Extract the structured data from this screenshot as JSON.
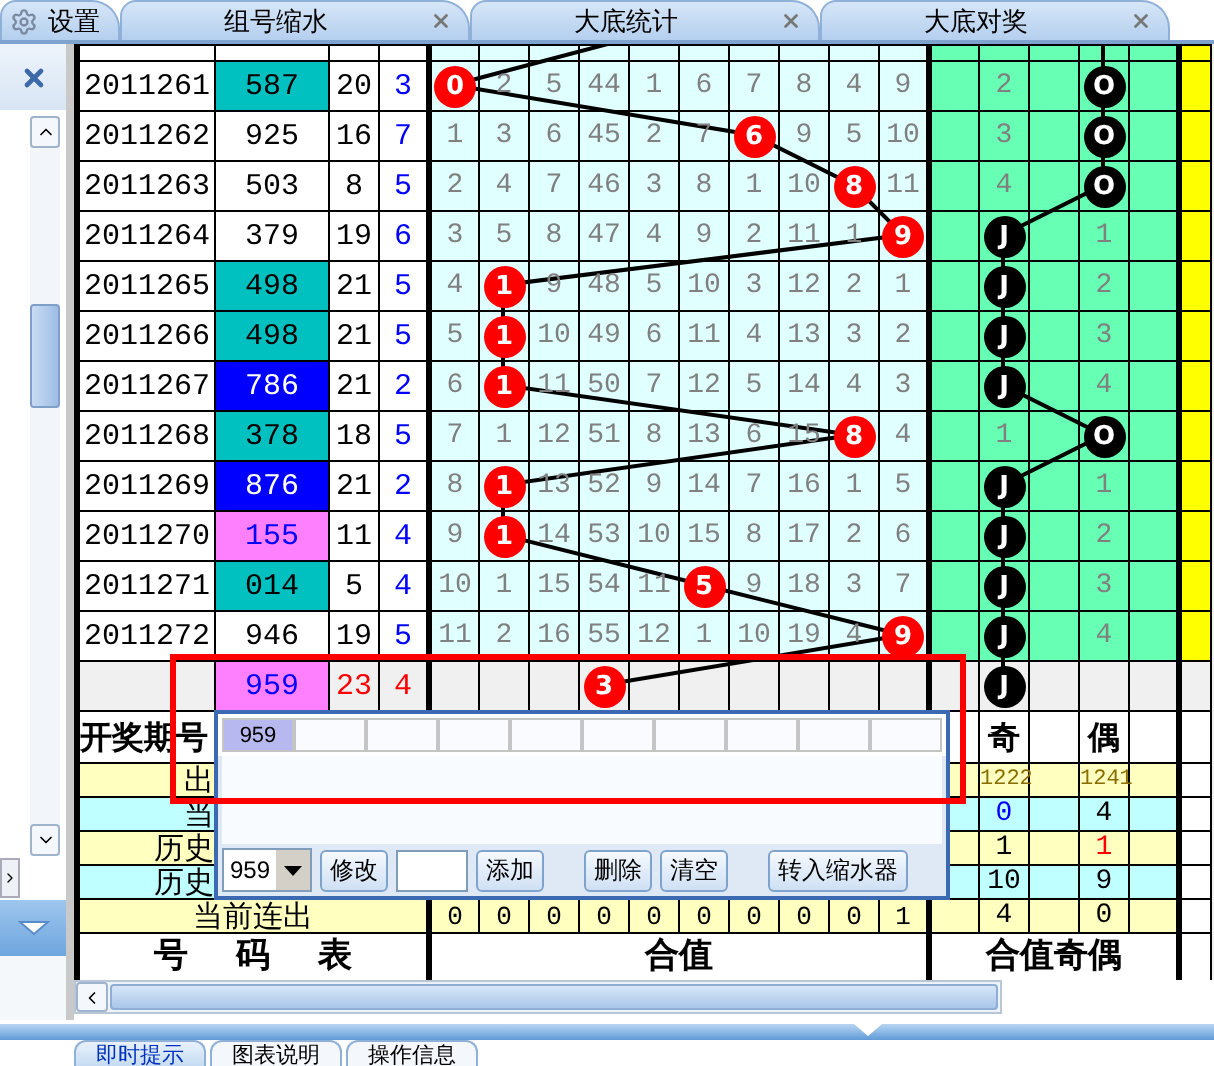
{
  "tabs": [
    {
      "label": "设置",
      "kind": "settings",
      "selected": false
    },
    {
      "label": "组号缩水",
      "kind": "closable",
      "selected": false
    },
    {
      "label": "大底统计",
      "kind": "closable",
      "selected": false
    },
    {
      "label": "大底对奖",
      "kind": "closable",
      "selected": false
    }
  ],
  "rows": [
    {
      "kind": "draw",
      "period": "2011261",
      "number": "587",
      "color": "#00c0c0",
      "sum": "20",
      "tail": "3",
      "cells": [
        {
          "kind": "ball",
          "text": "0"
        },
        {
          "kind": "num",
          "text": "2"
        },
        {
          "kind": "num",
          "text": "5"
        },
        {
          "kind": "num",
          "text": "44"
        },
        {
          "kind": "num",
          "text": "1"
        },
        {
          "kind": "num",
          "text": "6"
        },
        {
          "kind": "num",
          "text": "7"
        },
        {
          "kind": "num",
          "text": "8"
        },
        {
          "kind": "num",
          "text": "4"
        },
        {
          "kind": "num",
          "text": "9"
        }
      ],
      "parity": {
        "kind": "even",
        "ball": "O",
        "count": "2"
      }
    },
    {
      "kind": "draw",
      "period": "2011262",
      "number": "925",
      "color": "#ffffff",
      "sum": "16",
      "tail": "7",
      "cells": [
        {
          "kind": "num",
          "text": "1"
        },
        {
          "kind": "num",
          "text": "3"
        },
        {
          "kind": "num",
          "text": "6"
        },
        {
          "kind": "num",
          "text": "45"
        },
        {
          "kind": "num",
          "text": "2"
        },
        {
          "kind": "num",
          "text": "7"
        },
        {
          "kind": "ball",
          "text": "6"
        },
        {
          "kind": "num",
          "text": "9"
        },
        {
          "kind": "num",
          "text": "5"
        },
        {
          "kind": "num",
          "text": "10"
        }
      ],
      "parity": {
        "kind": "even",
        "ball": "O",
        "count": "3"
      }
    },
    {
      "kind": "draw",
      "period": "2011263",
      "number": "503",
      "color": "#ffffff",
      "sum": "8",
      "tail": "5",
      "cells": [
        {
          "kind": "num",
          "text": "2"
        },
        {
          "kind": "num",
          "text": "4"
        },
        {
          "kind": "num",
          "text": "7"
        },
        {
          "kind": "num",
          "text": "46"
        },
        {
          "kind": "num",
          "text": "3"
        },
        {
          "kind": "num",
          "text": "8"
        },
        {
          "kind": "num",
          "text": "1"
        },
        {
          "kind": "num",
          "text": "10"
        },
        {
          "kind": "ball",
          "text": "8"
        },
        {
          "kind": "num",
          "text": "11"
        }
      ],
      "parity": {
        "kind": "even",
        "ball": "O",
        "count": "4"
      }
    },
    {
      "kind": "draw",
      "period": "2011264",
      "number": "379",
      "color": "#ffffff",
      "sum": "19",
      "tail": "6",
      "cells": [
        {
          "kind": "num",
          "text": "3"
        },
        {
          "kind": "num",
          "text": "5"
        },
        {
          "kind": "num",
          "text": "8"
        },
        {
          "kind": "num",
          "text": "47"
        },
        {
          "kind": "num",
          "text": "4"
        },
        {
          "kind": "num",
          "text": "9"
        },
        {
          "kind": "num",
          "text": "2"
        },
        {
          "kind": "num",
          "text": "11"
        },
        {
          "kind": "num",
          "text": "1"
        },
        {
          "kind": "ball",
          "text": "9"
        }
      ],
      "parity": {
        "kind": "odd",
        "ball": "J",
        "count": "1"
      }
    },
    {
      "kind": "draw",
      "period": "2011265",
      "number": "498",
      "color": "#00c0c0",
      "sum": "21",
      "tail": "5",
      "cells": [
        {
          "kind": "num",
          "text": "4"
        },
        {
          "kind": "ball",
          "text": "1"
        },
        {
          "kind": "num",
          "text": "9"
        },
        {
          "kind": "num",
          "text": "48"
        },
        {
          "kind": "num",
          "text": "5"
        },
        {
          "kind": "num",
          "text": "10"
        },
        {
          "kind": "num",
          "text": "3"
        },
        {
          "kind": "num",
          "text": "12"
        },
        {
          "kind": "num",
          "text": "2"
        },
        {
          "kind": "num",
          "text": "1"
        }
      ],
      "parity": {
        "kind": "odd",
        "ball": "J",
        "count": "2"
      }
    },
    {
      "kind": "draw",
      "period": "2011266",
      "number": "498",
      "color": "#00c0c0",
      "sum": "21",
      "tail": "5",
      "cells": [
        {
          "kind": "num",
          "text": "5"
        },
        {
          "kind": "ball",
          "text": "1"
        },
        {
          "kind": "num",
          "text": "10"
        },
        {
          "kind": "num",
          "text": "49"
        },
        {
          "kind": "num",
          "text": "6"
        },
        {
          "kind": "num",
          "text": "11"
        },
        {
          "kind": "num",
          "text": "4"
        },
        {
          "kind": "num",
          "text": "13"
        },
        {
          "kind": "num",
          "text": "3"
        },
        {
          "kind": "num",
          "text": "2"
        }
      ],
      "parity": {
        "kind": "odd",
        "ball": "J",
        "count": "3"
      }
    },
    {
      "kind": "draw",
      "period": "2011267",
      "number": "786",
      "color": "#0000ff",
      "sum": "21",
      "tail": "2",
      "cells": [
        {
          "kind": "num",
          "text": "6"
        },
        {
          "kind": "ball",
          "text": "1"
        },
        {
          "kind": "num",
          "text": "11"
        },
        {
          "kind": "num",
          "text": "50"
        },
        {
          "kind": "num",
          "text": "7"
        },
        {
          "kind": "num",
          "text": "12"
        },
        {
          "kind": "num",
          "text": "5"
        },
        {
          "kind": "num",
          "text": "14"
        },
        {
          "kind": "num",
          "text": "4"
        },
        {
          "kind": "num",
          "text": "3"
        }
      ],
      "parity": {
        "kind": "odd",
        "ball": "J",
        "count": "4"
      }
    },
    {
      "kind": "draw",
      "period": "2011268",
      "number": "378",
      "color": "#00c0c0",
      "sum": "18",
      "tail": "5",
      "cells": [
        {
          "kind": "num",
          "text": "7"
        },
        {
          "kind": "num",
          "text": "1"
        },
        {
          "kind": "num",
          "text": "12"
        },
        {
          "kind": "num",
          "text": "51"
        },
        {
          "kind": "num",
          "text": "8"
        },
        {
          "kind": "num",
          "text": "13"
        },
        {
          "kind": "num",
          "text": "6"
        },
        {
          "kind": "num",
          "text": "15"
        },
        {
          "kind": "ball",
          "text": "8"
        },
        {
          "kind": "num",
          "text": "4"
        }
      ],
      "parity": {
        "kind": "even",
        "ball": "O",
        "count": "1"
      }
    },
    {
      "kind": "draw",
      "period": "2011269",
      "number": "876",
      "color": "#0000ff",
      "sum": "21",
      "tail": "2",
      "cells": [
        {
          "kind": "num",
          "text": "8"
        },
        {
          "kind": "ball",
          "text": "1"
        },
        {
          "kind": "num",
          "text": "13"
        },
        {
          "kind": "num",
          "text": "52"
        },
        {
          "kind": "num",
          "text": "9"
        },
        {
          "kind": "num",
          "text": "14"
        },
        {
          "kind": "num",
          "text": "7"
        },
        {
          "kind": "num",
          "text": "16"
        },
        {
          "kind": "num",
          "text": "1"
        },
        {
          "kind": "num",
          "text": "5"
        }
      ],
      "parity": {
        "kind": "odd",
        "ball": "J",
        "count": "1"
      }
    },
    {
      "kind": "draw",
      "period": "2011270",
      "number": "155",
      "color": "#ff80ff",
      "sum": "11",
      "tail": "4",
      "cells": [
        {
          "kind": "num",
          "text": "9"
        },
        {
          "kind": "ball",
          "text": "1"
        },
        {
          "kind": "num",
          "text": "14"
        },
        {
          "kind": "num",
          "text": "53"
        },
        {
          "kind": "num",
          "text": "10"
        },
        {
          "kind": "num",
          "text": "15"
        },
        {
          "kind": "num",
          "text": "8"
        },
        {
          "kind": "num",
          "text": "17"
        },
        {
          "kind": "num",
          "text": "2"
        },
        {
          "kind": "num",
          "text": "6"
        }
      ],
      "parity": {
        "kind": "odd",
        "ball": "J",
        "count": "2"
      }
    },
    {
      "kind": "draw",
      "period": "2011271",
      "number": "014",
      "color": "#00c0c0",
      "sum": "5",
      "tail": "4",
      "cells": [
        {
          "kind": "num",
          "text": "10"
        },
        {
          "kind": "num",
          "text": "1"
        },
        {
          "kind": "num",
          "text": "15"
        },
        {
          "kind": "num",
          "text": "54"
        },
        {
          "kind": "num",
          "text": "11"
        },
        {
          "kind": "ball",
          "text": "5"
        },
        {
          "kind": "num",
          "text": "9"
        },
        {
          "kind": "num",
          "text": "18"
        },
        {
          "kind": "num",
          "text": "3"
        },
        {
          "kind": "num",
          "text": "7"
        }
      ],
      "parity": {
        "kind": "odd",
        "ball": "J",
        "count": "3"
      }
    },
    {
      "kind": "draw",
      "period": "2011272",
      "number": "946",
      "color": "#ffffff",
      "sum": "19",
      "tail": "5",
      "cells": [
        {
          "kind": "num",
          "text": "11"
        },
        {
          "kind": "num",
          "text": "2"
        },
        {
          "kind": "num",
          "text": "16"
        },
        {
          "kind": "num",
          "text": "55"
        },
        {
          "kind": "num",
          "text": "12"
        },
        {
          "kind": "num",
          "text": "1"
        },
        {
          "kind": "num",
          "text": "10"
        },
        {
          "kind": "num",
          "text": "19"
        },
        {
          "kind": "num",
          "text": "4"
        },
        {
          "kind": "ball",
          "text": "9"
        }
      ],
      "parity": {
        "kind": "odd",
        "ball": "J",
        "count": "4"
      }
    },
    {
      "kind": "forecast",
      "number": "959",
      "color": "#ff80ff",
      "sum": "23",
      "tail": "4",
      "cells": [
        {
          "kind": "blank"
        },
        {
          "kind": "blank"
        },
        {
          "kind": "blank"
        },
        {
          "kind": "ball",
          "text": "3"
        },
        {
          "kind": "blank"
        },
        {
          "kind": "blank"
        },
        {
          "kind": "blank"
        },
        {
          "kind": "blank"
        },
        {
          "kind": "blank"
        },
        {
          "kind": "blank"
        }
      ],
      "parity": {
        "kind": "odd",
        "ball": "J"
      }
    }
  ],
  "header_row": {
    "label": "开奖期号",
    "odd": "奇",
    "even": "偶"
  },
  "stats": [
    {
      "label": "出",
      "odd": {
        "text": "1222"
      },
      "even": {
        "text": "1241"
      },
      "kind": "small"
    },
    {
      "label": "当",
      "odd": {
        "text": "0",
        "color": "#0000ff"
      },
      "even": {
        "text": "4"
      },
      "kind": "normal"
    },
    {
      "label": "历史",
      "odd": {
        "text": "1"
      },
      "even": {
        "text": "1",
        "color": "#ff0000"
      },
      "kind": "normal"
    },
    {
      "label": "历史",
      "odd": {
        "text": "10"
      },
      "even": {
        "text": "9"
      },
      "kind": "normal"
    }
  ],
  "streak_row": {
    "label": "当前连出",
    "values": [
      "0",
      "0",
      "0",
      "0",
      "0",
      "0",
      "0",
      "0",
      "0",
      "1"
    ],
    "odd": "4",
    "even": "0"
  },
  "footer": {
    "numbers": "号 码 表",
    "sum": "合值",
    "parity": "合值奇偶"
  },
  "dialog": {
    "cells": [
      "959"
    ],
    "combo": "959",
    "toolbar": [
      {
        "kind": "button",
        "label": "修改"
      },
      {
        "kind": "input"
      },
      {
        "kind": "button",
        "label": "添加"
      },
      {
        "kind": "gap"
      },
      {
        "kind": "button",
        "label": "删除"
      },
      {
        "kind": "button",
        "label": "清空"
      },
      {
        "kind": "gap"
      },
      {
        "kind": "button",
        "label": "转入缩水器"
      }
    ]
  },
  "bottom_tabs": [
    {
      "label": "即时提示",
      "selected": true
    },
    {
      "label": "图表说明",
      "selected": false
    },
    {
      "label": "操作信息",
      "selected": false
    }
  ]
}
